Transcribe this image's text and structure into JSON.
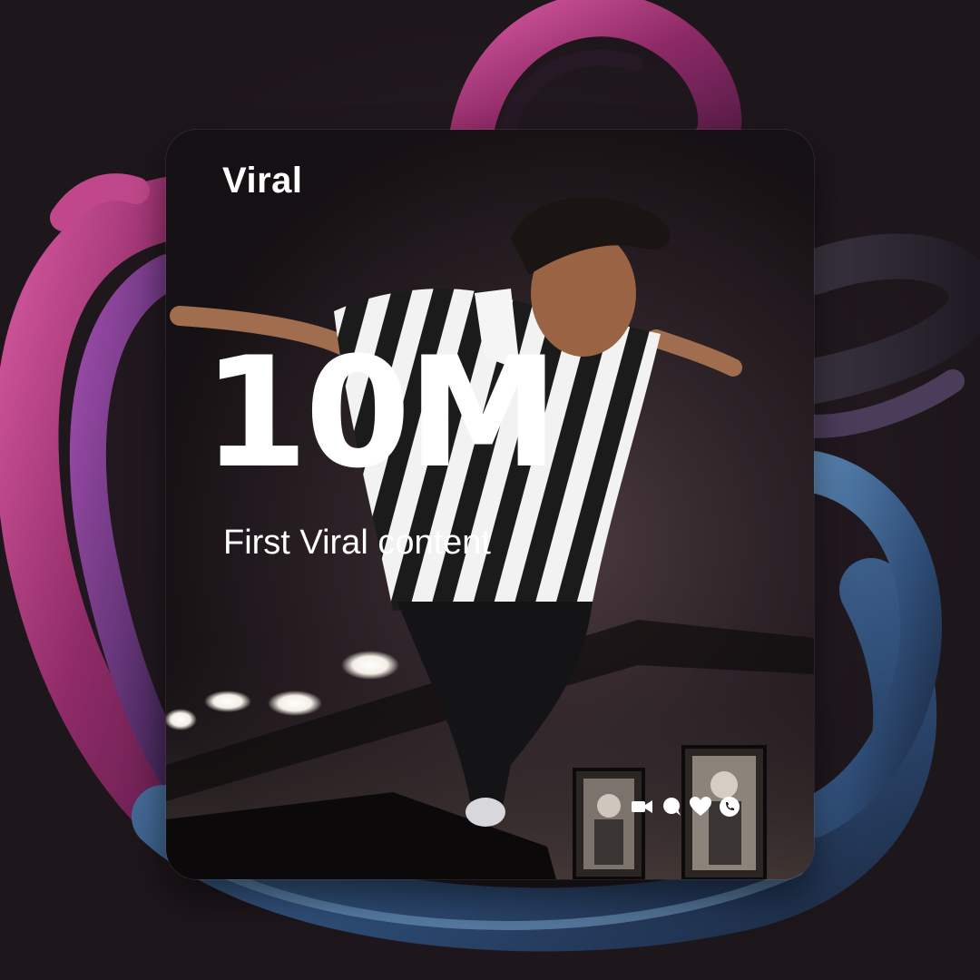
{
  "card": {
    "heading": "Viral",
    "stat": "10M",
    "subtitle": "First Viral content"
  },
  "icons": [
    "video-camera-icon",
    "chat-bubble-icon",
    "heart-icon",
    "phone-icon"
  ],
  "colors": {
    "background": "#1f181d",
    "ribbon_magenta": "#b0336f",
    "ribbon_purple": "#7a3a8c",
    "ribbon_blue": "#3f6f9a",
    "text": "#ffffff"
  }
}
